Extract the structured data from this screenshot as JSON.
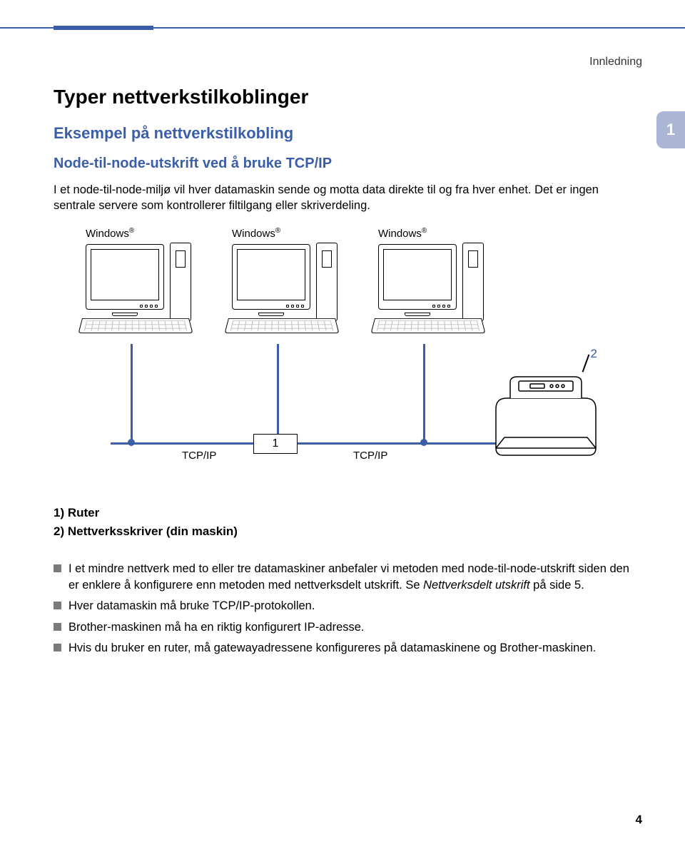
{
  "running_head": "Innledning",
  "section_tab": "1",
  "title": "Typer nettverkstilkoblinger",
  "subtitle": "Eksempel på nettverkstilkobling",
  "subsub": "Node-til-node-utskrift ved å bruke TCP/IP",
  "intro": "I et node-til-node-miljø vil hver datamaskin sende og motta data direkte til og fra hver enhet. Det er ingen sentrale servere som kontrollerer filtilgang eller skriverdeling.",
  "diagram": {
    "os_label": "Windows",
    "os_reg": "®",
    "tcpip": "TCP/IP",
    "router_ref": "1",
    "printer_ref": "2"
  },
  "legend": {
    "l1": "1) Ruter",
    "l2": "2) Nettverksskriver (din maskin)"
  },
  "notes": [
    {
      "pre": "I et mindre nettverk med to eller tre datamaskiner anbefaler vi metoden med node-til-node-utskrift siden den er enklere å konfigurere enn metoden med nettverksdelt utskrift. Se ",
      "italic": "Nettverksdelt utskrift",
      "post": " på side 5."
    },
    {
      "pre": "Hver datamaskin må bruke TCP/IP-protokollen."
    },
    {
      "pre": "Brother-maskinen må ha en riktig konfigurert IP-adresse."
    },
    {
      "pre": "Hvis du bruker en ruter, må gatewayadressene konfigureres på datamaskinene og Brother-maskinen."
    }
  ],
  "page_number": "4"
}
